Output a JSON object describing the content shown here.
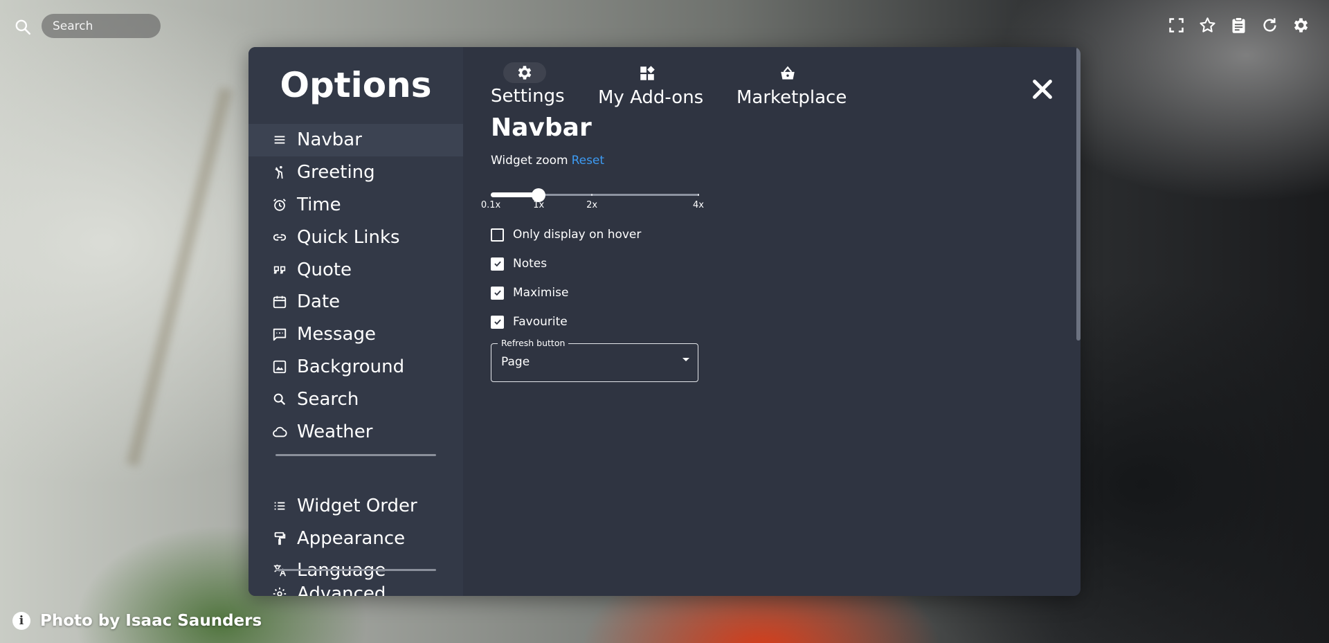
{
  "topbar": {
    "search_placeholder": "Search",
    "icons": [
      "fullscreen-icon",
      "star-icon",
      "clipboard-icon",
      "refresh-icon",
      "gear-icon"
    ]
  },
  "credit": {
    "text": "Photo by Isaac Saunders"
  },
  "modal": {
    "title": "Options",
    "tabs": [
      {
        "label": "Settings",
        "icon": "gear-icon"
      },
      {
        "label": "My Add-ons",
        "icon": "addons-icon"
      },
      {
        "label": "Marketplace",
        "icon": "basket-icon"
      }
    ],
    "sidebar": {
      "items": [
        {
          "label": "Navbar",
          "icon": "menu-icon"
        },
        {
          "label": "Greeting",
          "icon": "waving-person-icon"
        },
        {
          "label": "Time",
          "icon": "alarm-icon"
        },
        {
          "label": "Quick Links",
          "icon": "link-icon"
        },
        {
          "label": "Quote",
          "icon": "quote-icon"
        },
        {
          "label": "Date",
          "icon": "calendar-icon"
        },
        {
          "label": "Message",
          "icon": "message-icon"
        },
        {
          "label": "Background",
          "icon": "image-icon"
        },
        {
          "label": "Search",
          "icon": "search-icon"
        },
        {
          "label": "Weather",
          "icon": "cloud-icon"
        }
      ],
      "group2": [
        {
          "label": "Widget Order",
          "icon": "list-icon"
        },
        {
          "label": "Appearance",
          "icon": "paint-roller-icon"
        },
        {
          "label": "Language",
          "icon": "translate-icon"
        }
      ],
      "group3": [
        {
          "label": "Advanced",
          "icon": "settings-cog-icon"
        }
      ]
    },
    "section": {
      "title": "Navbar",
      "zoom_label": "Widget zoom",
      "reset_label": "Reset",
      "zoom": {
        "min": 0.1,
        "max": 4,
        "value": 1,
        "marks": [
          "0.1x",
          "1x",
          "2x",
          "4x"
        ]
      },
      "checkboxes": [
        {
          "label": "Only display on hover",
          "checked": false
        },
        {
          "label": "Notes",
          "checked": true
        },
        {
          "label": "Maximise",
          "checked": true
        },
        {
          "label": "Favourite",
          "checked": true
        }
      ],
      "refresh": {
        "legend": "Refresh button",
        "value": "Page"
      }
    }
  }
}
